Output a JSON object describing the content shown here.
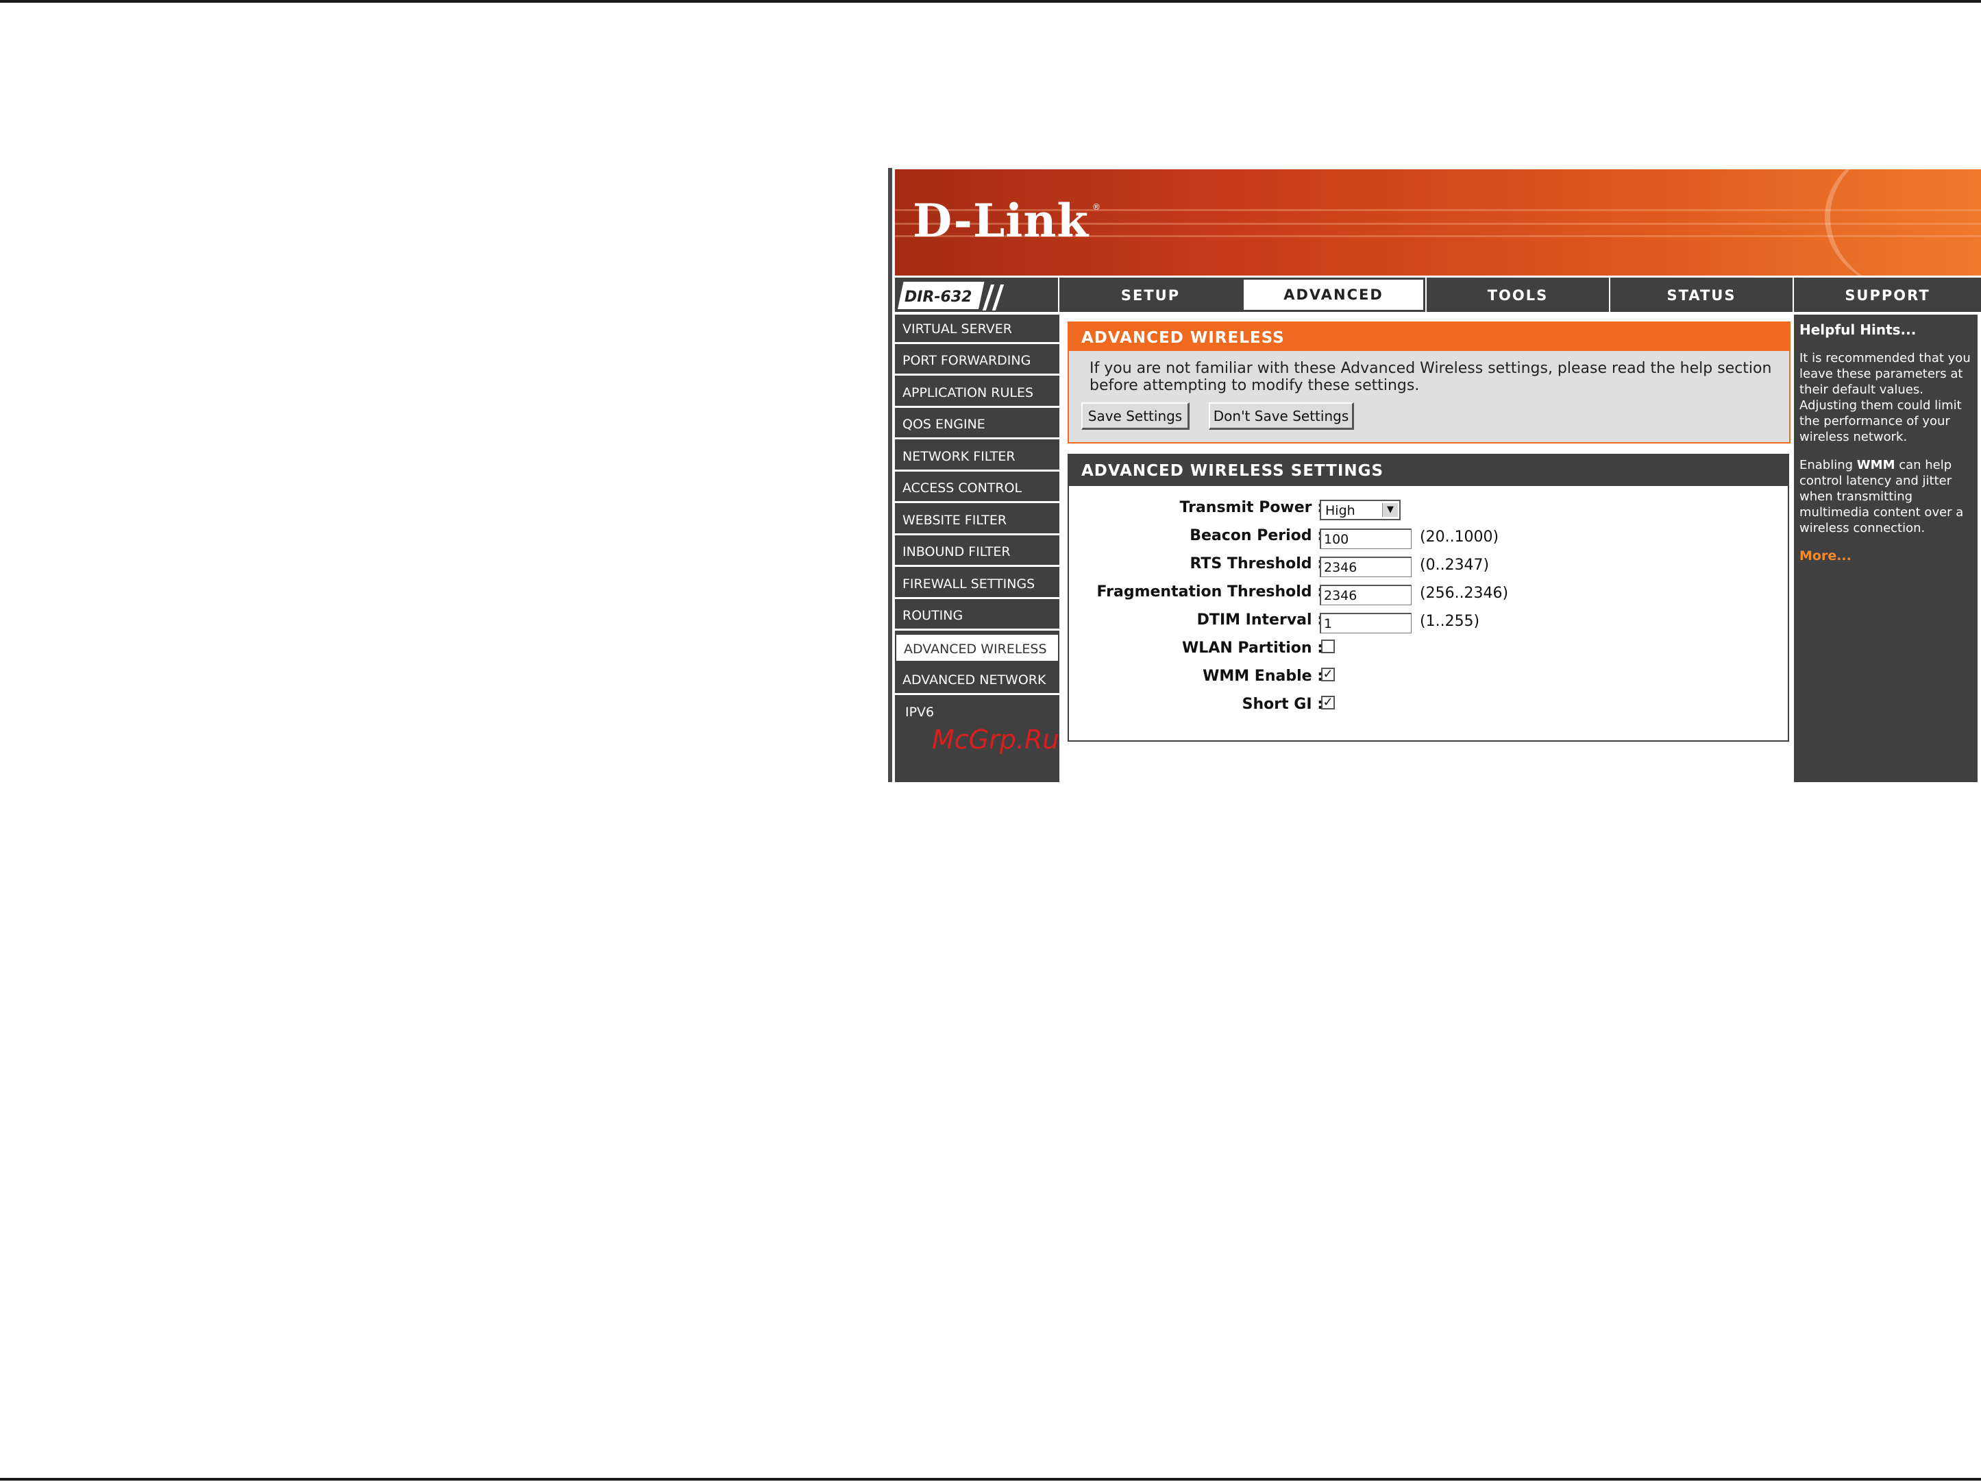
{
  "brand": {
    "logo_text": "D-Link",
    "registered_mark": "®",
    "model": "DIR-632"
  },
  "tabs": [
    {
      "label": "SETUP"
    },
    {
      "label": "ADVANCED",
      "active": true
    },
    {
      "label": "TOOLS"
    },
    {
      "label": "STATUS"
    },
    {
      "label": "SUPPORT"
    }
  ],
  "sidebar": {
    "items": [
      {
        "label": "VIRTUAL SERVER"
      },
      {
        "label": "PORT FORWARDING"
      },
      {
        "label": "APPLICATION RULES"
      },
      {
        "label": "QOS ENGINE"
      },
      {
        "label": "NETWORK FILTER"
      },
      {
        "label": "ACCESS CONTROL"
      },
      {
        "label": "WEBSITE FILTER"
      },
      {
        "label": "INBOUND FILTER"
      },
      {
        "label": "FIREWALL SETTINGS"
      },
      {
        "label": "ROUTING"
      },
      {
        "label": "ADVANCED WIRELESS",
        "active": true
      },
      {
        "label": "ADVANCED NETWORK"
      },
      {
        "label": "IPV6"
      }
    ],
    "watermark": "McGrp.Ru"
  },
  "warning_box": {
    "title": "ADVANCED WIRELESS",
    "text": "If you are not familiar with these Advanced Wireless settings, please read the help section before attempting to modify these settings.",
    "save_label": "Save Settings",
    "dont_save_label": "Don't Save Settings"
  },
  "settings": {
    "title": "ADVANCED WIRELESS SETTINGS",
    "transmit_power": {
      "label": "Transmit Power :",
      "value": "High"
    },
    "beacon_period": {
      "label": "Beacon Period :",
      "value": "100",
      "range": "(20..1000)"
    },
    "rts_threshold": {
      "label": "RTS Threshold :",
      "value": "2346",
      "range": "(0..2347)"
    },
    "fragmentation_threshold": {
      "label": "Fragmentation Threshold :",
      "value": "2346",
      "range": "(256..2346)"
    },
    "dtim_interval": {
      "label": "DTIM Interval :",
      "value": "1",
      "range": "(1..255)"
    },
    "wlan_partition": {
      "label": "WLAN Partition :",
      "checked": false
    },
    "wmm_enable": {
      "label": "WMM Enable :",
      "checked": true
    },
    "short_gi": {
      "label": "Short GI :",
      "checked": true
    }
  },
  "hints": {
    "title": "Helpful Hints...",
    "p1": "It is recommended that you leave these parameters at their default values. Adjusting them could limit the performance of your wireless network.",
    "p2_before": "Enabling ",
    "p2_bold": "WMM",
    "p2_after": " can help control latency and jitter when transmitting multimedia content over a wireless connection.",
    "more": "More..."
  },
  "colors": {
    "accent_orange": "#ef6a1e",
    "dark_gray": "#404040",
    "link_orange": "#f58a2c"
  }
}
